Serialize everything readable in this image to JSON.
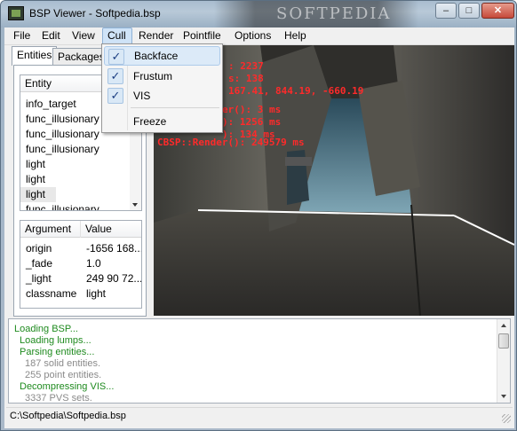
{
  "window": {
    "title": "BSP Viewer - Softpedia.bsp",
    "watermark": "SOFTPEDIA",
    "buttons": {
      "minimize": "–",
      "maximize": "□",
      "close": "✕"
    }
  },
  "menubar": {
    "items": [
      {
        "label": "File"
      },
      {
        "label": "Edit"
      },
      {
        "label": "View"
      },
      {
        "label": "Cull"
      },
      {
        "label": "Render"
      },
      {
        "label": "Pointfile"
      },
      {
        "label": "Options"
      },
      {
        "label": "Help"
      }
    ]
  },
  "cull_menu": {
    "items": [
      {
        "label": "Backface",
        "checked": true
      },
      {
        "label": "Frustum",
        "checked": true
      },
      {
        "label": "VIS",
        "checked": true
      },
      {
        "label": "Freeze",
        "checked": false
      }
    ],
    "check_glyph": "✓"
  },
  "tabs": [
    {
      "label": "Entities"
    },
    {
      "label": "Packages"
    }
  ],
  "entity_list": {
    "header": "Entity",
    "rows": [
      "info_target",
      "func_illusionary",
      "func_illusionary",
      "func_illusionary",
      "light",
      "light",
      "light",
      "func_illusionary"
    ]
  },
  "property_table": {
    "headers": [
      "Argument",
      "Value"
    ],
    "rows": [
      {
        "arg": "origin",
        "value": "-1656 168..."
      },
      {
        "arg": "_fade",
        "value": "1.0"
      },
      {
        "arg": "_light",
        "value": "249 90 72..."
      },
      {
        "arg": "classname",
        "value": "light"
      }
    ]
  },
  "viewport_overlay": [
    ": 2237",
    "s: 138",
    "167.41, 844.19, -660.19",
    "er(): 3 ms",
    "): 1256 ms",
    "): 134 ms",
    "CBSP::Render(): 249579 ms"
  ],
  "log": {
    "lines": [
      {
        "text": "Loading BSP...",
        "indent": 0,
        "color": "#1e8a1e"
      },
      {
        "text": "Loading lumps...",
        "indent": 1,
        "color": "#1e8a1e"
      },
      {
        "text": "Parsing entities...",
        "indent": 1,
        "color": "#1e8a1e"
      },
      {
        "text": "187 solid entities.",
        "indent": 2,
        "color": "#8a8a8a"
      },
      {
        "text": "255 point entities.",
        "indent": 2,
        "color": "#8a8a8a"
      },
      {
        "text": "Decompressing VIS...",
        "indent": 1,
        "color": "#1e8a1e"
      },
      {
        "text": "3337 PVS sets.",
        "indent": 2,
        "color": "#8a8a8a"
      }
    ]
  },
  "statusbar": {
    "text": "C:\\Softpedia\\Softpedia.bsp"
  },
  "colors": {
    "overlay_text": "#ff2a2a",
    "menu_highlight": "#dceaf8"
  }
}
